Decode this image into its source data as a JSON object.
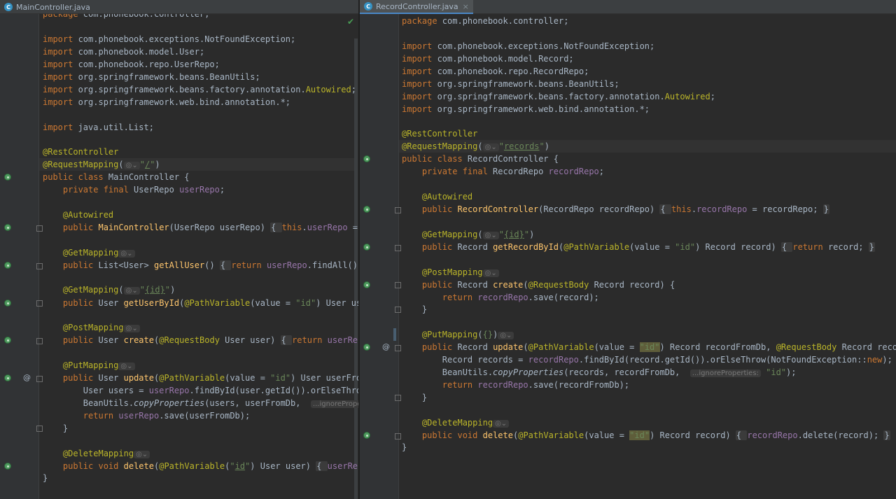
{
  "tabs": {
    "left_title": "MainController.java",
    "right_title": "RecordController.java",
    "close_glyph": "×"
  },
  "left": {
    "code": [
      "<span class=\"kw\">package</span> com.phonebook.controller;",
      "<span class=\"kw\">import</span> com.phonebook.exceptions.NotFoundException;",
      "<span class=\"kw\">import</span> com.phonebook.model.User;",
      "<span class=\"kw\">import</span> com.phonebook.repo.UserRepo;",
      "<span class=\"kw\">import</span> org.springframework.beans.BeanUtils;",
      "<span class=\"kw\">import</span> org.springframework.beans.factory.annotation.<span class=\"ann\">Autowired</span>;",
      "<span class=\"kw\">import</span> org.springframework.web.bind.annotation.*;",
      "<span class=\"kw\">import</span> java.util.List;",
      "<span class=\"ann\">@RestController</span>",
      "<span class=\"ann\">@RequestMapping</span>(<span class=\"hint\">◎⌄</span><span class=\"str\">\"<span class=\"und\">/</span>\"</span>)",
      "<span class=\"kw\">public class</span> MainController {",
      "    <span class=\"kw\">private final</span> UserRepo <span class=\"fld\">userRepo</span>;",
      "    <span class=\"ann\">@Autowired</span>",
      "    <span class=\"kw\">public</span> <span class=\"mth\">MainController</span>(UserRepo userRepo) <span class=\"fold\">{ </span><span class=\"kw\">this</span>.<span class=\"fld\">userRepo</span> = userRepo; }",
      "    <span class=\"ann\">@GetMapping</span><span class=\"hint\">◎⌄</span>",
      "    <span class=\"kw\">public</span> List&lt;User&gt; <span class=\"mth\">getAllUser</span>() <span class=\"fold\">{ </span><span class=\"kw\">return</span> <span class=\"fld\">userRepo</span>.findAll(); <span class=\"fold\">}</span>",
      "    <span class=\"ann\">@GetMapping</span>(<span class=\"hint\">◎⌄</span><span class=\"str\">\"<span class=\"und\">{id}</span>\"</span>)",
      "    <span class=\"kw\">public</span> User <span class=\"mth\">getUserById</span>(<span class=\"ann\">@PathVariable</span>(value = <span class=\"str\">\"id\"</span>) User user) {",
      "    <span class=\"ann\">@PostMapping</span><span class=\"hint\">◎⌄</span>",
      "    <span class=\"kw\">public</span> User <span class=\"mth\">create</span>(<span class=\"ann\">@RequestBody</span> User user) <span class=\"fold\">{ </span><span class=\"kw\">return</span> <span class=\"fld\">userRepo</span>.save(user); }",
      "    <span class=\"ann\">@PutMapping</span><span class=\"hint\">◎⌄</span>",
      "    <span class=\"kw\">public</span> User <span class=\"mth\">update</span>(<span class=\"ann\">@PathVariable</span>(value = <span class=\"str\">\"id\"</span>) User userFromDb,",
      "        User users = <span class=\"fld\">userRepo</span>.findById(user.getId()).orElseThrow(NotFoundException::new);",
      "        BeanUtils.<span class=\"ita\">copyProperties</span>(users, userFromDb,  <span class=\"hint\">...ignoreProperties:</span> <span class=\"str\">\"id\"</span>);",
      "        <span class=\"kw\">return</span> <span class=\"fld\">userRepo</span>.save(userFromDb);",
      "    }",
      "    <span class=\"ann\">@DeleteMapping</span><span class=\"hint\">◎⌄</span>",
      "    <span class=\"kw\">public void</span> <span class=\"mth\">delete</span>(<span class=\"ann\">@PathVariable</span>(<span class=\"str\">\"<span class=\"und\">id</span>\"</span>) User user) <span class=\"fold\">{ </span><span class=\"fld\">userRepo</span>.delete(user); }",
      "}"
    ]
  },
  "right": {
    "code": [
      "<span class=\"kw\">package</span> com.phonebook.controller;",
      "<span class=\"kw\">import</span> com.phonebook.exceptions.NotFoundException;",
      "<span class=\"kw\">import</span> com.phonebook.model.Record;",
      "<span class=\"kw\">import</span> com.phonebook.repo.RecordRepo;",
      "<span class=\"kw\">import</span> org.springframework.beans.BeanUtils;",
      "<span class=\"kw\">import</span> org.springframework.beans.factory.annotation.<span class=\"ann\">Autowired</span>;",
      "<span class=\"kw\">import</span> org.springframework.web.bind.annotation.*;",
      "<span class=\"ann\">@RestController</span>",
      "<span class=\"ann\">@RequestMapping</span>(<span class=\"hint\">◎⌄</span><span class=\"str\">\"<span class=\"und\">records</span>\"</span>)",
      "<span class=\"kw\">public class</span> RecordController {",
      "    <span class=\"kw\">private final</span> RecordRepo <span class=\"fld\">recordRepo</span>;",
      "    <span class=\"ann\">@Autowired</span>",
      "    <span class=\"kw\">public</span> <span class=\"mth\">RecordController</span>(RecordRepo recordRepo) <span class=\"fold\">{ </span><span class=\"kw\">this</span>.<span class=\"fld\">recordRepo</span> = recordRepo; <span class=\"fold\">}</span>",
      "    <span class=\"ann\">@GetMapping</span>(<span class=\"hint\">◎⌄</span><span class=\"str\">\"<span class=\"und\">{id}</span>\"</span>)",
      "    <span class=\"kw\">public</span> Record <span class=\"mth\">getRecordById</span>(<span class=\"ann\">@PathVariable</span>(value = <span class=\"str\">\"id\"</span>) Record record) <span class=\"fold\">{ </span><span class=\"kw\">return</span> record; <span class=\"fold\">}</span>",
      "    <span class=\"ann\">@PostMapping</span><span class=\"hint\">◎⌄</span>",
      "    <span class=\"kw\">public</span> Record <span class=\"mth\">create</span>(<span class=\"ann\">@RequestBody</span> Record record) {",
      "        <span class=\"kw\">return</span> <span class=\"fld\">recordRepo</span>.save(record);",
      "    }",
      "    <span class=\"ann\">@PutMapping</span>(<span class=\"str\">{}</span>)<span class=\"hint\">◎⌄</span>",
      "    <span class=\"kw\">public</span> Record <span class=\"mth\">update</span>(<span class=\"ann\">@PathVariable</span>(value = <span class=\"str\"><span class=\"sel\">\"id\"</span></span>) Record recordFromDb, <span class=\"ann\">@RequestBody</span> Record record) {",
      "        Record records = <span class=\"fld\">recordRepo</span>.findById(record.getId()).orElseThrow(NotFoundException::<span class=\"kw\">new</span>);",
      "        BeanUtils.<span class=\"ita\">copyProperties</span>(records, recordFromDb,  <span class=\"hint\">...ignoreProperties:</span> <span class=\"str\">\"id\"</span>);",
      "        <span class=\"kw\">return</span> <span class=\"fld\">recordRepo</span>.save(recordFromDb);",
      "    }",
      "    <span class=\"ann\">@DeleteMapping</span><span class=\"hint\">◎⌄</span>",
      "    <span class=\"kw\">public void</span> <span class=\"mth\">delete</span>(<span class=\"ann\">@PathVariable</span>(value = <span class=\"str\"><span class=\"sel\">\"id\"</span></span>) Record record) <span class=\"fold\">{ </span><span class=\"fld\">recordRepo</span>.delete(record); <span class=\"fold\">}</span>",
      "}"
    ]
  },
  "gutter": {
    "override_marker": "@",
    "check_mark": "✔"
  },
  "colors": {
    "background": "#2b2b2b",
    "keyword": "#cc7832",
    "annotation": "#bbb529",
    "field": "#9876aa",
    "string": "#6a8759",
    "method": "#ffc66d",
    "text": "#a9b7c6"
  },
  "icons": [
    "class-c-icon",
    "spring-bean-icon",
    "override-icon",
    "fold-icon",
    "close-icon",
    "check-icon"
  ]
}
